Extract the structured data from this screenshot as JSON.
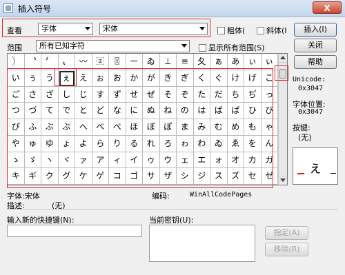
{
  "window": {
    "title": "插入符号",
    "close_label": "X"
  },
  "view": {
    "label": "查看",
    "category_value": "字体",
    "font_value": "宋体",
    "bold_label": "粗体(",
    "italic_label": "斜体(I",
    "insert_label": "插入(I)"
  },
  "range": {
    "label": "范围",
    "value": "所有已知字符",
    "show_all_label": "显示所有范围(S)",
    "close_label": "关闭",
    "help_label": "帮助"
  },
  "grid": {
    "rows": [
      [
        "〗",
        "〝",
        "〞",
        "〟",
        "〰",
        "〾",
        "〿",
        "ー",
        "ゐ",
        "⊥",
        "≡",
        "夂",
        "ぁ",
        "あ",
        "ぃ",
        "ぃ"
      ],
      [
        "い",
        "ぅ",
        "う",
        "ぇ",
        "え",
        "ぉ",
        "お",
        "か",
        "が",
        "き",
        "ぎ",
        "く",
        "ぐ",
        "け",
        "げ",
        "こ"
      ],
      [
        "ご",
        "さ",
        "ざ",
        "し",
        "じ",
        "す",
        "ず",
        "せ",
        "ぜ",
        "そ",
        "ぞ",
        "た",
        "だ",
        "ち",
        "ぢ",
        "っ"
      ],
      [
        "つ",
        "づ",
        "て",
        "で",
        "と",
        "ど",
        "な",
        "に",
        "ぬ",
        "ね",
        "の",
        "は",
        "ば",
        "ぱ",
        "ひ",
        "び"
      ],
      [
        "ぴ",
        "ふ",
        "ぶ",
        "ぷ",
        "へ",
        "べ",
        "ぺ",
        "ほ",
        "ぼ",
        "ぽ",
        "ま",
        "み",
        "む",
        "め",
        "も",
        "ゃ"
      ],
      [
        "や",
        "ゅ",
        "ゆ",
        "ょ",
        "よ",
        "ら",
        "り",
        "る",
        "れ",
        "ろ",
        "ゎ",
        "わ",
        "ゐ",
        "ゑ",
        "を",
        "ん"
      ],
      [
        "ゝ",
        "ゞ",
        "ヽ",
        "ヾ",
        "ァ",
        "ア",
        "ィ",
        "イ",
        "ゥ",
        "ウ",
        "ェ",
        "エ",
        "ォ",
        "オ",
        "カ",
        "ガ"
      ],
      [
        "キ",
        "ギ",
        "ク",
        "グ",
        "ケ",
        "ゲ",
        "コ",
        "ゴ",
        "サ",
        "ザ",
        "シ",
        "ジ",
        "ス",
        "ズ",
        "セ",
        "ゼ"
      ]
    ],
    "selected": "ぇ"
  },
  "info": {
    "unicode_label": "Unicode:",
    "unicode_value": "0x3047",
    "font_pos_label": "字体位置:",
    "font_pos_value": "0x3047",
    "key_label": "按键:",
    "key_value": "(无)",
    "preview_char": "ぇ"
  },
  "status": {
    "font_label": "字体:宋体",
    "encoding_label": "编码:",
    "encoding_value": "WinAllCodePages",
    "desc_label": "描述:",
    "desc_value": "(无)"
  },
  "shortcut": {
    "new_label": "输入新的快捷键(N):",
    "current_label": "当前密钥(U):",
    "assign_label": "指定(A)",
    "remove_label": "移除(R)"
  }
}
